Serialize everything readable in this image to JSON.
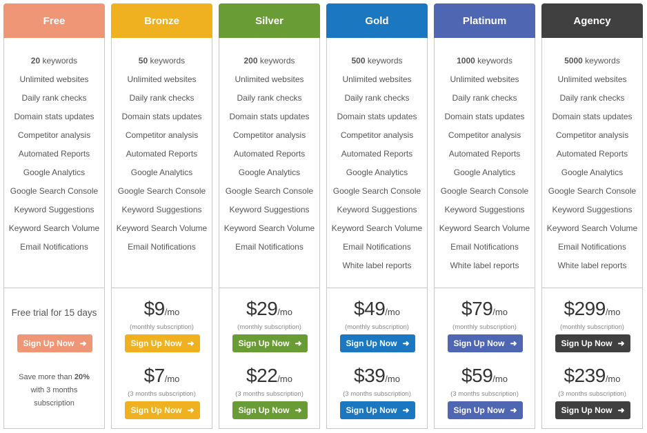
{
  "free": {
    "name": "Free",
    "color": "#ef9676",
    "features": [
      "20 keywords",
      "Unlimited websites",
      "Daily rank checks",
      "Domain stats updates",
      "Competitor analysis",
      "Automated Reports",
      "Google Analytics",
      "Google Search Console",
      "Keyword Suggestions",
      "Keyword Search Volume",
      "Email Notifications"
    ],
    "trial_text": "Free trial for 15 days",
    "button_label": "Sign Up Now",
    "save_prefix": "Save more than ",
    "save_bold": "20%",
    "save_line2": "with 3 months",
    "save_line3": "subscription"
  },
  "plans": [
    {
      "name": "Bronze",
      "color": "#efb11f",
      "features": [
        "50 keywords",
        "Unlimited websites",
        "Daily rank checks",
        "Domain stats updates",
        "Competitor analysis",
        "Automated Reports",
        "Google Analytics",
        "Google Search Console",
        "Keyword Suggestions",
        "Keyword Search Volume",
        "Email Notifications"
      ],
      "monthly_price": "$9",
      "monthly_per": "/mo",
      "monthly_label": "(monthly subscription)",
      "quarterly_price": "$7",
      "quarterly_per": "/mo",
      "quarterly_label": "(3 months subscription)",
      "button_label": "Sign Up Now"
    },
    {
      "name": "Silver",
      "color": "#6a9c36",
      "features": [
        "200 keywords",
        "Unlimited websites",
        "Daily rank checks",
        "Domain stats updates",
        "Competitor analysis",
        "Automated Reports",
        "Google Analytics",
        "Google Search Console",
        "Keyword Suggestions",
        "Keyword Search Volume",
        "Email Notifications"
      ],
      "monthly_price": "$29",
      "monthly_per": "/mo",
      "monthly_label": "(monthly subscription)",
      "quarterly_price": "$22",
      "quarterly_per": "/mo",
      "quarterly_label": "(3 months subscription)",
      "button_label": "Sign Up Now"
    },
    {
      "name": "Gold",
      "color": "#1b78c0",
      "features": [
        "500 keywords",
        "Unlimited websites",
        "Daily rank checks",
        "Domain stats updates",
        "Competitor analysis",
        "Automated Reports",
        "Google Analytics",
        "Google Search Console",
        "Keyword Suggestions",
        "Keyword Search Volume",
        "Email Notifications",
        "White label reports"
      ],
      "monthly_price": "$49",
      "monthly_per": "/mo",
      "monthly_label": "(monthly subscription)",
      "quarterly_price": "$39",
      "quarterly_per": "/mo",
      "quarterly_label": "(3 months subscription)",
      "button_label": "Sign Up Now"
    },
    {
      "name": "Platinum",
      "color": "#4f66b3",
      "features": [
        "1000 keywords",
        "Unlimited websites",
        "Daily rank checks",
        "Domain stats updates",
        "Competitor analysis",
        "Automated Reports",
        "Google Analytics",
        "Google Search Console",
        "Keyword Suggestions",
        "Keyword Search Volume",
        "Email Notifications",
        "White label reports"
      ],
      "monthly_price": "$79",
      "monthly_per": "/mo",
      "monthly_label": "(monthly subscription)",
      "quarterly_price": "$59",
      "quarterly_per": "/mo",
      "quarterly_label": "(3 months subscription)",
      "button_label": "Sign Up Now"
    },
    {
      "name": "Agency",
      "color": "#404040",
      "features": [
        "5000 keywords",
        "Unlimited websites",
        "Daily rank checks",
        "Domain stats updates",
        "Competitor analysis",
        "Automated Reports",
        "Google Analytics",
        "Google Search Console",
        "Keyword Suggestions",
        "Keyword Search Volume",
        "Email Notifications",
        "White label reports"
      ],
      "monthly_price": "$299",
      "monthly_per": "/mo",
      "monthly_label": "(monthly subscription)",
      "quarterly_price": "$239",
      "quarterly_per": "/mo",
      "quarterly_label": "(3 months subscription)",
      "button_label": "Sign Up Now"
    }
  ],
  "icons": {
    "button_arrow": "arrow-right-icon"
  }
}
